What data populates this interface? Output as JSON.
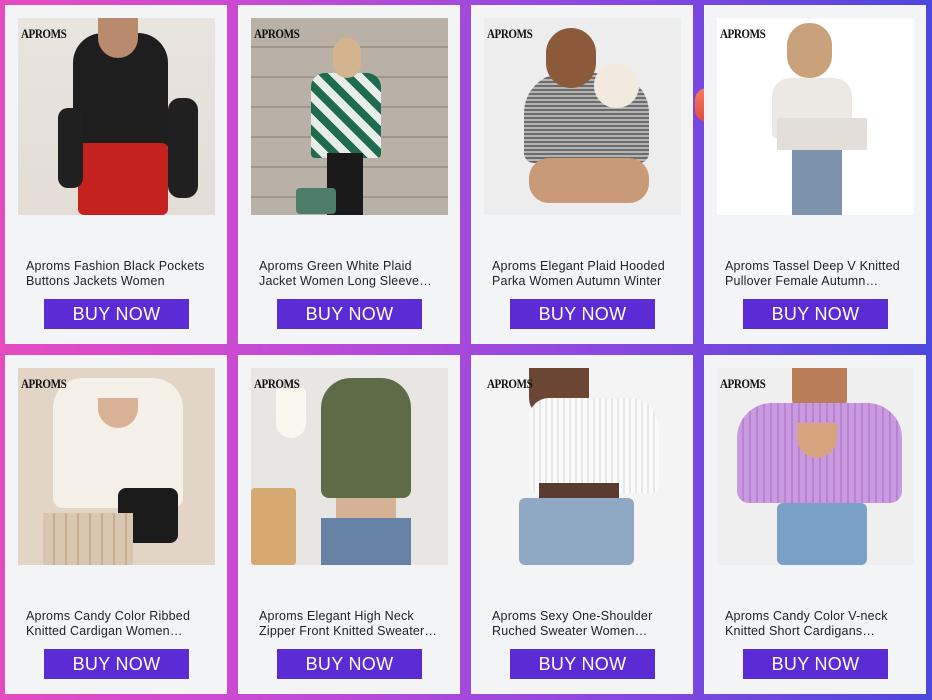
{
  "products": [
    {
      "brand": "APROMS",
      "title": "Aproms Fashion Black Pockets Buttons Jackets Women",
      "button": "BUY NOW"
    },
    {
      "brand": "APROMS",
      "title": "Aproms Green White Plaid Jacket Women Long Sleeve Coat",
      "button": "BUY NOW"
    },
    {
      "brand": "APROMS",
      "title": "Aproms Elegant Plaid Hooded Parka Women Autumn Winter",
      "button": "BUY NOW"
    },
    {
      "brand": "APROMS",
      "title": "Aproms Tassel Deep V Knitted Pullover Female Autumn Sweater",
      "button": "BUY NOW"
    },
    {
      "brand": "APROMS",
      "title": "Aproms Candy Color Ribbed Knitted Cardigan Women Sweater",
      "button": "BUY NOW"
    },
    {
      "brand": "APROMS",
      "title": "Aproms Elegant High Neck Zipper Front Knitted Sweater Women",
      "button": "BUY NOW"
    },
    {
      "brand": "APROMS",
      "title": "Aproms Sexy One-Shoulder Ruched Sweater Women Autumn",
      "button": "BUY NOW"
    },
    {
      "brand": "APROMS",
      "title": "Aproms Candy Color V-neck Knitted Short Cardigans Women",
      "button": "BUY NOW"
    }
  ]
}
